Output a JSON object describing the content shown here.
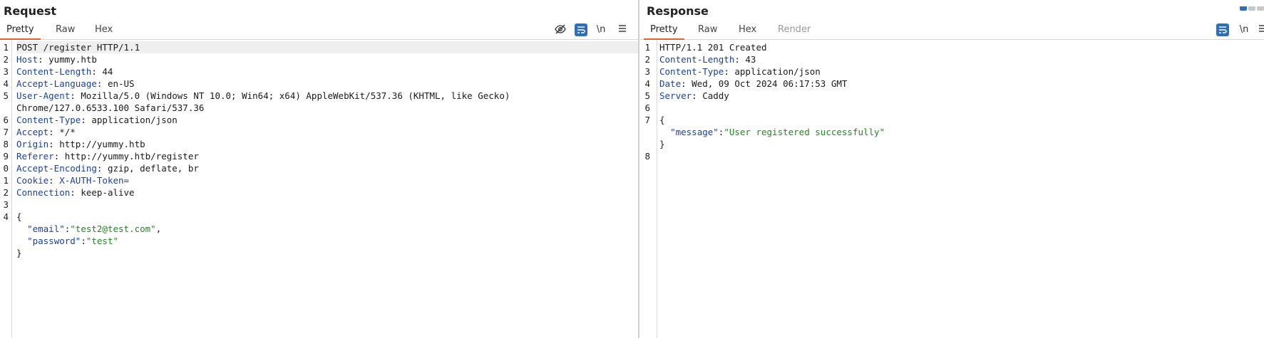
{
  "request": {
    "title": "Request",
    "tabs": [
      {
        "label": "Pretty"
      },
      {
        "label": "Raw"
      },
      {
        "label": "Hex"
      }
    ],
    "tools": {
      "hide_icon": "eye-off-icon",
      "wrap_icon": "wrap-icon",
      "newline_label": "\\n",
      "menu_icon": "menu-icon"
    },
    "lines": [
      {
        "n": "1",
        "plain": "POST /register HTTP/1.1"
      },
      {
        "n": "2",
        "key": "Host",
        "val": ": yummy.htb"
      },
      {
        "n": "3",
        "key": "Content-Length",
        "val": ": 44"
      },
      {
        "n": "4",
        "key": "Accept-Language",
        "val": ": en-US"
      },
      {
        "n": "5",
        "key": "User-Agent",
        "val": ": Mozilla/5.0 (Windows NT 10.0; Win64; x64) AppleWebKit/537.36 (KHTML, like Gecko)"
      },
      {
        "n": "",
        "plain": "Chrome/127.0.6533.100 Safari/537.36"
      },
      {
        "n": "6",
        "key": "Content-Type",
        "val": ": application/json"
      },
      {
        "n": "7",
        "key": "Accept",
        "val": ": */*"
      },
      {
        "n": "8",
        "key": "Origin",
        "val": ": http://yummy.htb"
      },
      {
        "n": "9",
        "key": "Referer",
        "val": ": http://yummy.htb/register"
      },
      {
        "n": "0",
        "key": "Accept-Encoding",
        "val": ": gzip, deflate, br"
      },
      {
        "n": "1",
        "key": "Cookie",
        "val": ": ",
        "cookie": "X-AUTH-Token="
      },
      {
        "n": "2",
        "key": "Connection",
        "val": ": keep-alive"
      },
      {
        "n": "3",
        "plain": ""
      },
      {
        "n": "4",
        "plain": "{"
      },
      {
        "n": "",
        "jkey": "\"email\"",
        "jsep": ":",
        "jval": "\"test2@test.com\"",
        "jend": ","
      },
      {
        "n": "",
        "jkey": "\"password\"",
        "jsep": ":",
        "jval": "\"test\"",
        "jend": ""
      },
      {
        "n": "",
        "plain": "}"
      }
    ]
  },
  "response": {
    "title": "Response",
    "tabs": [
      {
        "label": "Pretty"
      },
      {
        "label": "Raw"
      },
      {
        "label": "Hex"
      },
      {
        "label": "Render"
      }
    ],
    "tools": {
      "wrap_icon": "wrap-icon",
      "newline_label": "\\n",
      "menu_icon": "menu-icon"
    },
    "lines": [
      {
        "n": "1",
        "plain": "HTTP/1.1 201 Created"
      },
      {
        "n": "2",
        "key": "Content-Length",
        "val": ": 43"
      },
      {
        "n": "3",
        "key": "Content-Type",
        "val": ": application/json"
      },
      {
        "n": "4",
        "key": "Date",
        "val": ": Wed, 09 Oct 2024 06:17:53 GMT"
      },
      {
        "n": "5",
        "key": "Server",
        "val": ": Caddy"
      },
      {
        "n": "6",
        "plain": ""
      },
      {
        "n": "7",
        "plain": "{"
      },
      {
        "n": "",
        "jkey": "\"message\"",
        "jsep": ":",
        "jval": "\"User registered successfully\"",
        "jend": ""
      },
      {
        "n": "",
        "plain": "}"
      },
      {
        "n": "8",
        "plain": ""
      }
    ]
  },
  "colors": {
    "header_key": "#1b3fa6",
    "json_string": "#1f8a1f",
    "active_tab": "#e8602c",
    "tool_blue": "#2f6fb6"
  }
}
